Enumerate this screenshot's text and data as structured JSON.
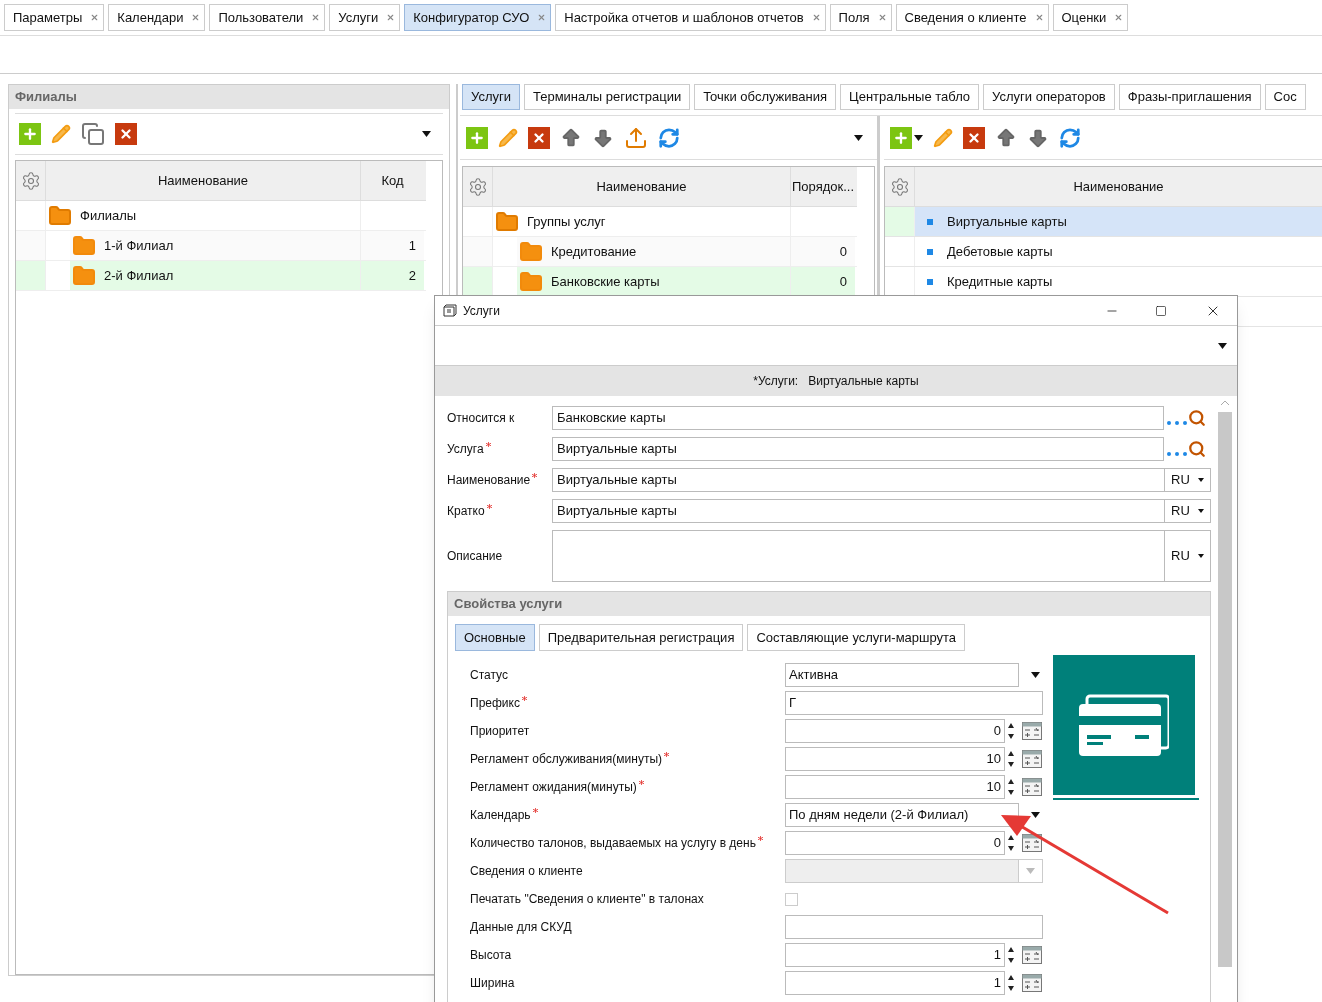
{
  "top_tabs": [
    {
      "label": "Параметры",
      "selected": false
    },
    {
      "label": "Календари",
      "selected": false
    },
    {
      "label": "Пользователи",
      "selected": false
    },
    {
      "label": "Услуги",
      "selected": false
    },
    {
      "label": "Конфигуратор СУО",
      "selected": true
    },
    {
      "label": "Настройка отчетов и шаблонов отчетов",
      "selected": false
    },
    {
      "label": "Поля",
      "selected": false
    },
    {
      "label": "Сведения о клиенте",
      "selected": false
    },
    {
      "label": "Оценки",
      "selected": false
    }
  ],
  "branches": {
    "title": "Филиалы",
    "columns": [
      "Наименование",
      "Код"
    ],
    "tree": {
      "name": "Филиалы",
      "children": [
        {
          "name": "1-й Филиал",
          "value": "1",
          "selected": false
        },
        {
          "name": "2-й Филиал",
          "value": "2",
          "selected": true
        }
      ]
    }
  },
  "config_tabs": [
    {
      "label": "Услуги",
      "selected": true
    },
    {
      "label": "Терминалы регистрации",
      "selected": false
    },
    {
      "label": "Точки обслуживания",
      "selected": false
    },
    {
      "label": "Центральные табло",
      "selected": false
    },
    {
      "label": "Услуги операторов",
      "selected": false
    },
    {
      "label": "Фразы-приглашения",
      "selected": false
    },
    {
      "label": "Сос",
      "selected": false
    }
  ],
  "groups": {
    "columns": [
      "Наименование",
      "Порядок..."
    ],
    "tree": {
      "name": "Группы услуг",
      "children": [
        {
          "name": "Кредитование",
          "value": "0",
          "selected": false
        },
        {
          "name": "Банковские карты",
          "value": "0",
          "selected": true
        }
      ]
    }
  },
  "services": {
    "column": "Наименование",
    "rows": [
      {
        "name": "Виртуальные карты",
        "selected": true
      },
      {
        "name": "Дебетовые карты",
        "selected": false
      },
      {
        "name": "Кредитные карты",
        "selected": false
      }
    ]
  },
  "dialog": {
    "title": "Услуги",
    "header_label": "*Услуги:",
    "header_value": "Виртуальные карты",
    "fields": [
      {
        "kind": "lookup",
        "label": "Относится к",
        "required": false,
        "value": "Банковские карты"
      },
      {
        "kind": "lookup",
        "label": "Услуга",
        "required": true,
        "value": "Виртуальные карты"
      },
      {
        "kind": "lang",
        "label": "Наименование",
        "required": true,
        "value": "Виртуальные карты",
        "lang": "RU"
      },
      {
        "kind": "lang",
        "label": "Кратко",
        "required": true,
        "value": "Виртуальные  карты",
        "lang": "RU"
      },
      {
        "kind": "textarea",
        "label": "Описание",
        "required": false,
        "lang": "RU"
      }
    ],
    "section_title": "Свойства услуги",
    "sub_tabs": [
      {
        "label": "Основные",
        "selected": true
      },
      {
        "label": "Предварительная регистрация",
        "selected": false
      },
      {
        "label": "Составляющие услуги-маршрута",
        "selected": false
      }
    ],
    "properties": [
      {
        "kind": "select",
        "label": "Статус",
        "required": false,
        "value": "Активна"
      },
      {
        "kind": "text",
        "label": "Префикс",
        "required": true,
        "value": "Г"
      },
      {
        "kind": "spin",
        "label": "Приоритет",
        "required": false,
        "value": "0"
      },
      {
        "kind": "spin",
        "label": "Регламент обслуживания(минуты)",
        "required": true,
        "value": "10"
      },
      {
        "kind": "spin",
        "label": "Регламент ожидания(минуты)",
        "required": true,
        "value": "10"
      },
      {
        "kind": "select",
        "label": "Календарь",
        "required": true,
        "value": "По дням недели (2-й Филиал)",
        "focused": true
      },
      {
        "kind": "spin",
        "label": "Количество талонов, выдаваемых на услугу в день",
        "required": true,
        "value": "0"
      },
      {
        "kind": "disabled_select",
        "label": "Сведения о клиенте",
        "required": false
      },
      {
        "kind": "checkbox",
        "label": "Печатать \"Сведения о клиенте\" в талонах",
        "required": false,
        "checked": false
      },
      {
        "kind": "text",
        "label": "Данные для СКУД",
        "required": false
      },
      {
        "kind": "spin",
        "label": "Высота",
        "required": false,
        "value": "1"
      },
      {
        "kind": "spin",
        "label": "Ширина",
        "required": false,
        "value": "1"
      }
    ]
  }
}
